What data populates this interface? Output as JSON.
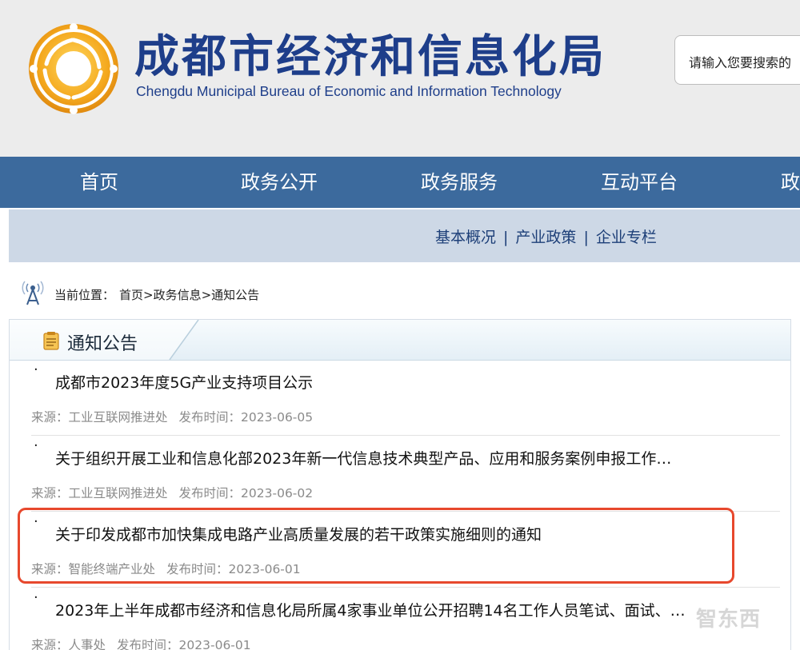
{
  "header": {
    "title_cn": "成都市经济和信息化局",
    "title_en": "Chengdu Municipal Bureau of Economic and Information Technology",
    "search_placeholder": "请输入您要搜索的"
  },
  "main_nav": {
    "items": [
      {
        "label": "首页"
      },
      {
        "label": "政务公开"
      },
      {
        "label": "政务服务"
      },
      {
        "label": "互动平台"
      },
      {
        "label": "政"
      }
    ]
  },
  "sub_nav": {
    "items": [
      {
        "label": "基本概况"
      },
      {
        "label": "产业政策"
      },
      {
        "label": "企业专栏"
      }
    ],
    "separator": "|"
  },
  "breadcrumb": {
    "prefix": "当前位置：",
    "path": "首页>政务信息>通知公告"
  },
  "panel": {
    "title": "通知公告"
  },
  "notices": [
    {
      "title": "成都市2023年度5G产业支持项目公示",
      "source_label": "来源：",
      "source": "工业互联网推进处",
      "date_label": "发布时间：",
      "date": "2023-06-05"
    },
    {
      "title": "关于组织开展工业和信息化部2023年新一代信息技术典型产品、应用和服务案例申报工作…",
      "source_label": "来源：",
      "source": "工业互联网推进处",
      "date_label": "发布时间：",
      "date": "2023-06-02"
    },
    {
      "title": "关于印发成都市加快集成电路产业高质量发展的若干政策实施细则的通知",
      "source_label": "来源：",
      "source": "智能终端产业处",
      "date_label": "发布时间：",
      "date": "2023-06-01"
    },
    {
      "title": "2023年上半年成都市经济和信息化局所属4家事业单位公开招聘14名工作人员笔试、面试、…",
      "source_label": "来源：",
      "source": "人事处",
      "date_label": "发布时间：",
      "date": "2023-06-01"
    }
  ],
  "bullet": "·",
  "watermark": "智东西",
  "colors": {
    "brand_blue": "#1e3e8a",
    "nav_bg": "#3c6a9d",
    "subnav_bg": "#cdd8e6",
    "highlight": "#e7482d",
    "logo_gold": "#f2a51c"
  }
}
